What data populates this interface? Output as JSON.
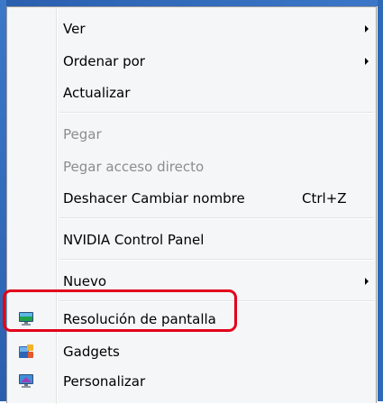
{
  "menu": {
    "items": [
      {
        "label": "Ver",
        "submenu": true
      },
      {
        "label": "Ordenar por",
        "submenu": true
      },
      {
        "label": "Actualizar"
      },
      {
        "label": "Pegar",
        "disabled": true
      },
      {
        "label": "Pegar acceso directo",
        "disabled": true
      },
      {
        "label": "Deshacer Cambiar nombre",
        "shortcut": "Ctrl+Z"
      },
      {
        "label": "NVIDIA Control Panel"
      },
      {
        "label": "Nuevo",
        "submenu": true
      },
      {
        "label": "Resolución de pantalla",
        "icon": "monitor-resolution-icon"
      },
      {
        "label": "Gadgets",
        "icon": "gadgets-icon"
      },
      {
        "label": "Personalizar",
        "icon": "personalize-icon"
      }
    ]
  },
  "colors": {
    "menu_background": "#f5f6f7",
    "disabled_text": "#8d8d8d",
    "highlight_border": "#e2001a",
    "desktop_blue": "#3c78c8"
  }
}
